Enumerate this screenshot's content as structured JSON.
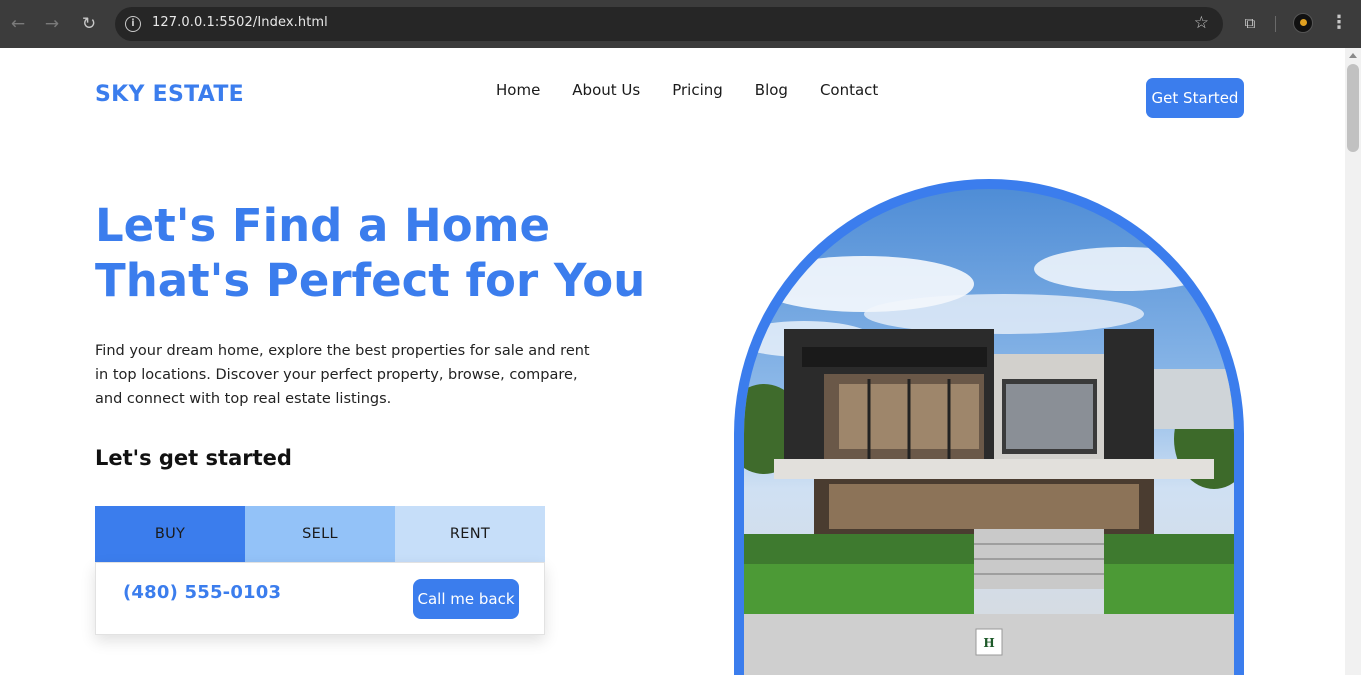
{
  "browser": {
    "url": "127.0.0.1:5502/Index.html"
  },
  "header": {
    "logo": "SKY ESTATE",
    "nav": [
      "Home",
      "About Us",
      "Pricing",
      "Blog",
      "Contact"
    ],
    "cta": "Get Started"
  },
  "hero": {
    "title_line1": "Let's Find a Home",
    "title_line2": "That's Perfect for You",
    "description": "Find your dream home, explore the best properties for sale and rent in top locations. Discover your perfect property, browse, compare, and connect with top real estate listings.",
    "subheading": "Let's get started",
    "tabs": [
      "BUY",
      "SELL",
      "RENT"
    ],
    "phone": "(480) 555-0103",
    "call_button": "Call me back"
  },
  "colors": {
    "accent": "#3b7ded",
    "tab_sell": "#93c2f8",
    "tab_rent": "#c6def9"
  }
}
